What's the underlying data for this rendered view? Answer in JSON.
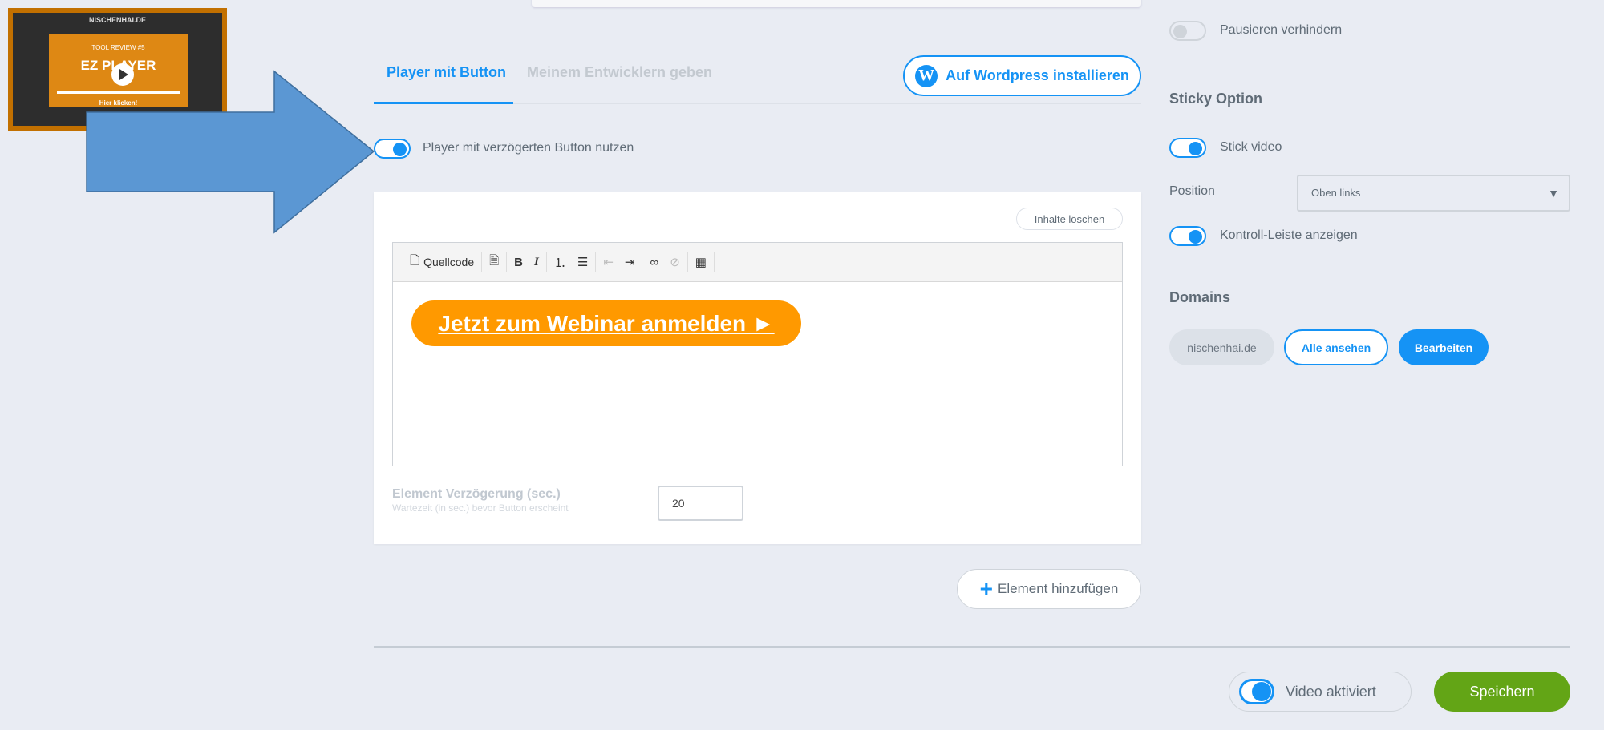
{
  "thumbnail": {
    "site": "NISCHENHAI.DE",
    "subtitle": "TOOL REVIEW #5",
    "title": "EZ PLAYER",
    "cta": "Hier klicken!"
  },
  "tabs": [
    {
      "label": "Player mit Button",
      "active": true
    },
    {
      "label": "Meinem Entwicklern geben",
      "active": false
    }
  ],
  "wordpress_button": "Auf Wordpress installieren",
  "delayed_button_toggle": {
    "label": "Player mit verzögerten Button nutzen",
    "on": true
  },
  "editor": {
    "clear_label": "Inhalte löschen",
    "toolbar": {
      "source": "Quellcode",
      "bold": "B",
      "italic": "I"
    },
    "content_button": "Jetzt zum Webinar anmelden ►",
    "content_button_color": "#ff9900"
  },
  "delay": {
    "label": "Element Verzögerung (sec.)",
    "sublabel": "Wartezeit (in sec.) bevor Button erscheint",
    "value": "20"
  },
  "add_element": "Element hinzufügen",
  "footer": {
    "video_active": "Video aktiviert",
    "video_active_on": true,
    "save": "Speichern",
    "save_color": "#63a516"
  },
  "sidebar": {
    "pause": {
      "label": "Pausieren verhindern",
      "on": false
    },
    "sticky_title": "Sticky Option",
    "stick_video": {
      "label": "Stick video",
      "on": true
    },
    "position_label": "Position",
    "position_value": "Oben links",
    "controls": {
      "label": "Kontroll-Leiste anzeigen",
      "on": true
    },
    "domains_title": "Domains",
    "domain": "nischenhai.de",
    "view_all": "Alle ansehen",
    "edit": "Bearbeiten"
  },
  "accent_color": "#1593f5"
}
